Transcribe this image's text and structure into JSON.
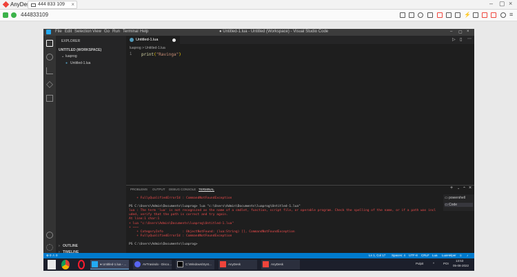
{
  "anydesk": {
    "app_name": "AnyDesk",
    "tab_label": "444 833 109",
    "address": "444833109",
    "colors": {
      "brand": "#ef443b",
      "status_green": "#3cb34a"
    }
  },
  "vscode": {
    "menu": [
      "File",
      "Edit",
      "Selection",
      "View",
      "Go",
      "Run",
      "Terminal",
      "Help"
    ],
    "title": "● Untitled-1.lua - Untitled (Workspace) - Visual Studio Code",
    "explorer": {
      "header": "EXPLORER",
      "workspace": "UNTITLED (WORKSPACE)",
      "folder": "luaprog",
      "file": "Untitled-1.lua",
      "outline": "OUTLINE",
      "timeline": "TIMELINE"
    },
    "tab": {
      "label": "Untitled-1.lua"
    },
    "breadcrumb": "luaprog > Untitled-1.lua",
    "line_number": "1",
    "code": {
      "fn": "print",
      "arg": "\"Ravinga\""
    },
    "panel_tabs": [
      "PROBLEMS",
      "OUTPUT",
      "DEBUG CONSOLE",
      "TERMINAL"
    ],
    "terminal_lines": [
      {
        "t": "    + FullyQualifiedErrorId : CommandNotFoundException",
        "c": "r"
      },
      {
        "t": "",
        "c": "w"
      },
      {
        "t": "PS C:\\Users\\Admin\\Documents\\luaprog> lua \"c:\\Users\\Admin\\Documents\\luaprog\\Untitled-1.lua\"",
        "c": "w"
      },
      {
        "t": "lua : The term 'lua' is not recognized as the name of a cmdlet, function, script file, or operable program. Check the spelling of the name, or if a path was incl",
        "c": "r"
      },
      {
        "t": "uded, verify that the path is correct and try again.",
        "c": "r"
      },
      {
        "t": "At line:1 char:1",
        "c": "r"
      },
      {
        "t": "+ lua \"c:\\Users\\Admin\\Documents\\luaprog\\Untitled-1.lua\"",
        "c": "r"
      },
      {
        "t": "+ ~~~",
        "c": "r"
      },
      {
        "t": "    + CategoryInfo          : ObjectNotFound: (lua:String) [], CommandNotFoundException",
        "c": "r"
      },
      {
        "t": "    + FullyQualifiedErrorId : CommandNotFoundException",
        "c": "r"
      },
      {
        "t": "",
        "c": "w"
      },
      {
        "t": "PS C:\\Users\\Admin\\Documents\\luaprog> ",
        "c": "w"
      }
    ],
    "shells": [
      "powershell",
      "Code"
    ],
    "status": {
      "left": "⊗ 0  ⚠ 0",
      "position": "Ln 1, Col 17",
      "spaces": "Spaces: 4",
      "encoding": "UTF-8",
      "eol": "CRLF",
      "language": "Lua",
      "extra": "LuaHelper"
    }
  },
  "taskbar": {
    "items": [
      "● Untitled-1.lua - ...",
      "AVTrasindo - Disco...",
      "C:\\Windows\\Syst...",
      "AnyDesk",
      "AnyDesk"
    ],
    "lang": "POI",
    "time": "13:53",
    "date": "05-08-2022",
    "region": "Pulpit"
  }
}
